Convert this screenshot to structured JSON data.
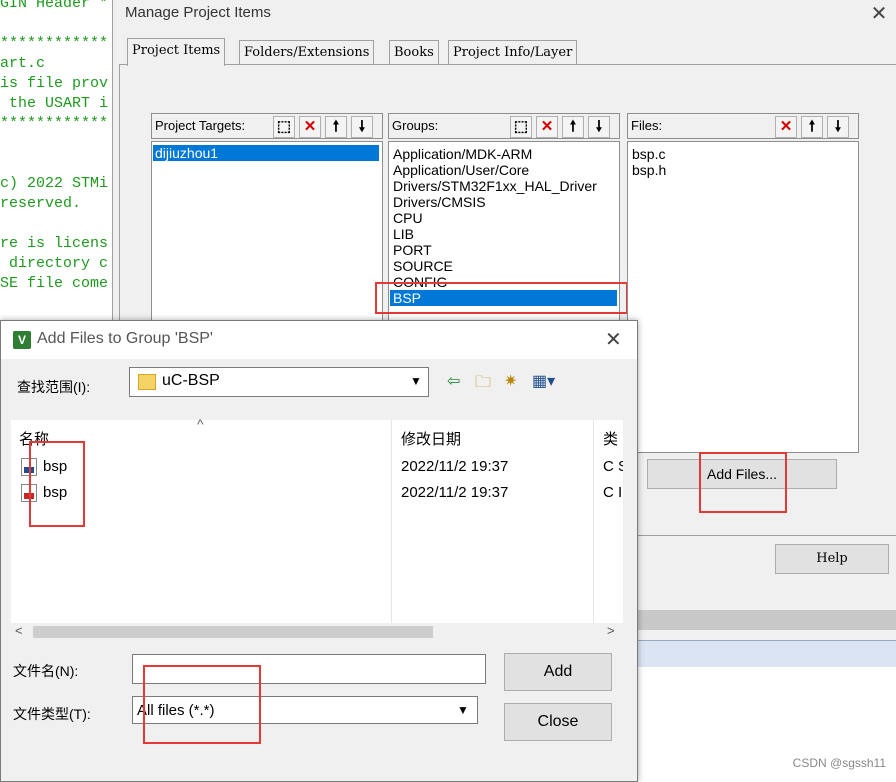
{
  "editor": {
    "lines": [
      "GIN Header *",
      "************",
      "art.c",
      "is file prov",
      " the USART i",
      "************",
      "",
      "",
      "c) 2022 STMi",
      "reserved.",
      "",
      "re is licens",
      " directory c",
      "SE file come"
    ]
  },
  "manage_dialog": {
    "title": "Manage Project Items",
    "close_glyph": "✕",
    "tabs": [
      "Project Items",
      "Folders/Extensions",
      "Books",
      "Project Info/Layer"
    ],
    "targets": {
      "label": "Project Targets:",
      "items": [
        "dijiuzhou1"
      ],
      "selected": "dijiuzhou1"
    },
    "groups": {
      "label": "Groups:",
      "items": [
        "Application/MDK-ARM",
        "Application/User/Core",
        "Drivers/STM32F1xx_HAL_Driver",
        "Drivers/CMSIS",
        "CPU",
        "LIB",
        "PORT",
        "SOURCE",
        "CONFIG",
        "BSP"
      ],
      "selected": "BSP"
    },
    "files": {
      "label": "Files:",
      "items": [
        "bsp.c",
        "bsp.h"
      ]
    },
    "add_files_button": "Add Files...",
    "help_button": "Help",
    "toolbar_glyphs": {
      "new": "⬚",
      "delete": "✕",
      "up": "🠕",
      "down": "🠗"
    }
  },
  "add_files_dialog": {
    "title": "Add Files to Group 'BSP'",
    "logo_glyph": "V",
    "close_glyph": "✕",
    "lookin_label": "查找范围(I):",
    "lookin_value": "uC-BSP",
    "columns": [
      "名称",
      "修改日期",
      "类"
    ],
    "rows": [
      {
        "name": "bsp",
        "date": "2022/11/2 19:37",
        "type": "C S"
      },
      {
        "name": "bsp",
        "date": "2022/11/2 19:37",
        "type": "C I"
      }
    ],
    "filename_label": "文件名(N):",
    "filename_value": "",
    "filetype_label": "文件类型(T):",
    "filetype_value": "All files (*.*)",
    "add_button": "Add",
    "close_button": "Close",
    "sort_glyph": "^",
    "scroll_left": "<",
    "scroll_right": ">"
  },
  "watermark": "CSDN @sgssh11",
  "colors": {
    "selection": "#0078d7",
    "highlight_box": "#e53935",
    "code": "#1f9a1f"
  }
}
